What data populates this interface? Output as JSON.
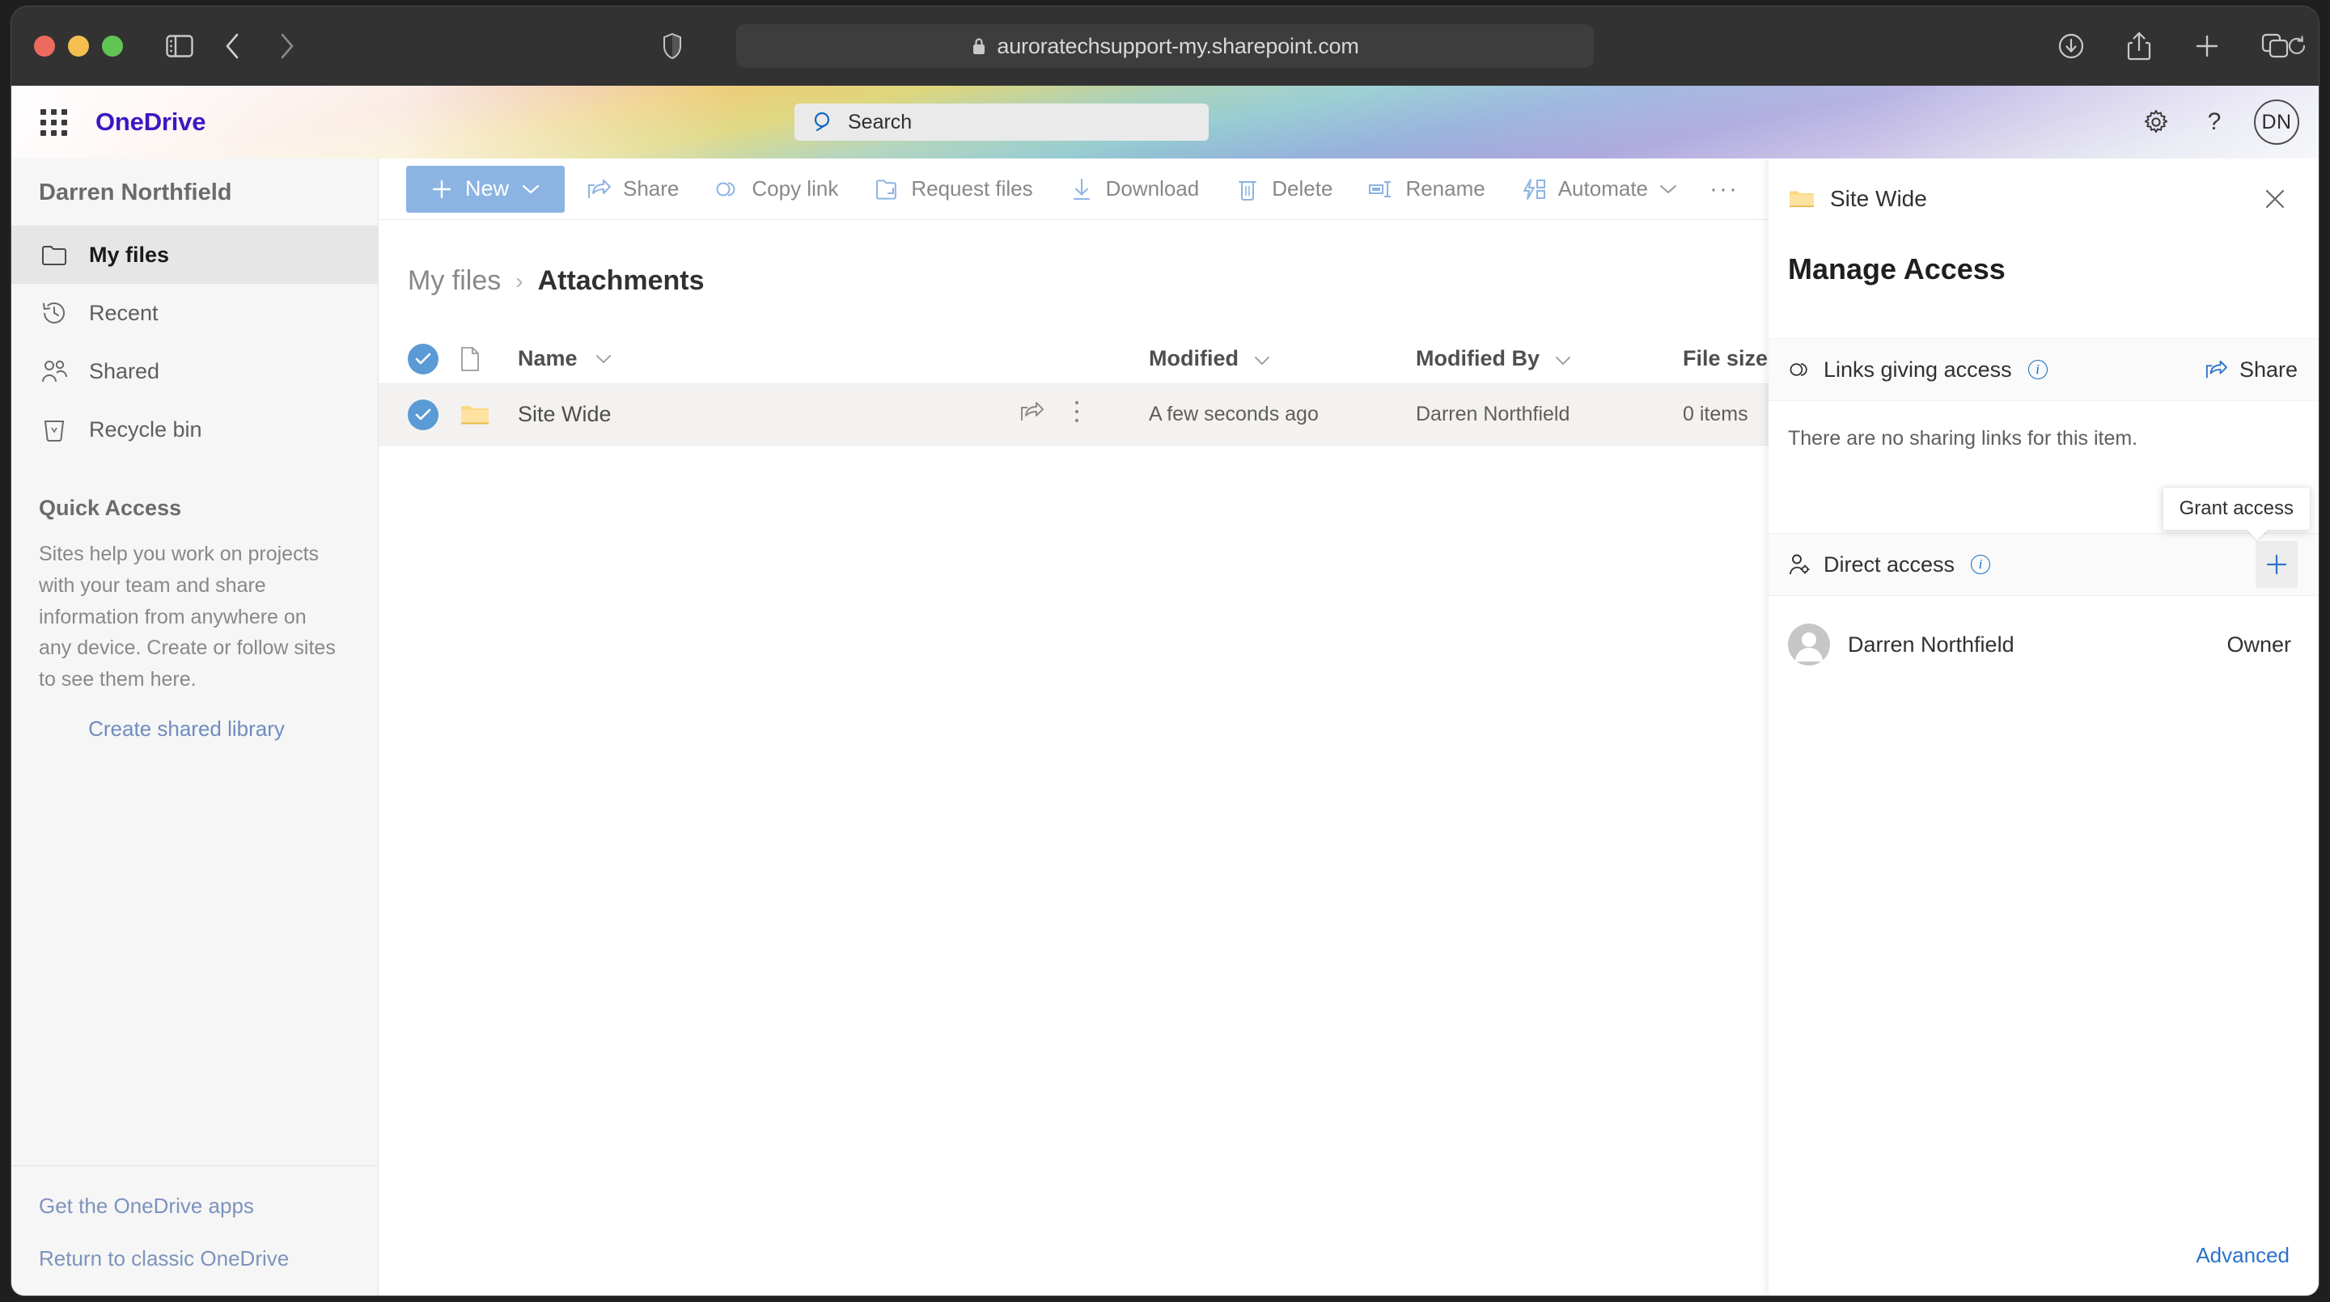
{
  "browser": {
    "url": "auroratechsupport-my.sharepoint.com",
    "lock_icon": "lock-icon",
    "back_icon": "back-chevron-icon",
    "forward_icon": "forward-chevron-icon",
    "sidebar_icon": "sidebar-toggle-icon",
    "shield_icon": "privacy-shield-icon",
    "reload_icon": "reload-icon",
    "downloads_icon": "downloads-icon",
    "share_icon": "share-icon",
    "newtab_icon": "new-tab-icon",
    "tabs_icon": "tab-overview-icon"
  },
  "suite_header": {
    "waffle_icon": "app-launcher-icon",
    "brand": "OneDrive",
    "brand_color": "#3b17c4",
    "search": {
      "placeholder": "Search",
      "icon": "search-icon"
    },
    "settings_icon": "gear-icon",
    "help_icon": "help-icon",
    "avatar_initials": "DN"
  },
  "sidebar": {
    "account_name": "Darren Northfield",
    "items": [
      {
        "label": "My files",
        "icon": "folder-icon",
        "active": true
      },
      {
        "label": "Recent",
        "icon": "clock-history-icon",
        "active": false
      },
      {
        "label": "Shared",
        "icon": "people-icon",
        "active": false
      },
      {
        "label": "Recycle bin",
        "icon": "trash-icon",
        "active": false
      }
    ],
    "quick_access": {
      "title": "Quick Access",
      "description": "Sites help you work on projects with your team and share information from anywhere on any device. Create or follow sites to see them here.",
      "link": "Create shared library"
    },
    "footer_links": [
      "Get the OneDrive apps",
      "Return to classic OneDrive"
    ]
  },
  "command_bar": {
    "new_button": {
      "label": "New",
      "plus_icon": "plus-icon",
      "chevron_icon": "chevron-down-icon",
      "color": "#8cb4e3"
    },
    "commands": [
      {
        "label": "Share",
        "icon": "share-arrow-icon"
      },
      {
        "label": "Copy link",
        "icon": "link-icon"
      },
      {
        "label": "Request files",
        "icon": "request-files-icon"
      },
      {
        "label": "Download",
        "icon": "download-arrow-icon"
      },
      {
        "label": "Delete",
        "icon": "trash-icon"
      },
      {
        "label": "Rename",
        "icon": "rename-icon"
      },
      {
        "label": "Automate",
        "icon": "automate-icon",
        "has_chevron": true
      }
    ],
    "overflow": "···"
  },
  "breadcrumb": {
    "root": "My files",
    "separator": "›",
    "current": "Attachments"
  },
  "file_list": {
    "columns": [
      {
        "label": "Name",
        "sortable": true
      },
      {
        "label": "Modified",
        "sortable": true
      },
      {
        "label": "Modified By",
        "sortable": true
      },
      {
        "label": "File size",
        "sortable": true
      }
    ],
    "select_all_checked": true,
    "rows": [
      {
        "name": "Site Wide",
        "icon": "folder-icon",
        "selected": true,
        "is_new": true,
        "modified": "A few seconds ago",
        "modified_by": "Darren Northfield",
        "size": "0 items",
        "row_share_icon": "share-arrow-icon",
        "row_more_icon": "more-vertical-icon"
      }
    ]
  },
  "details_panel": {
    "item_name": "Site Wide",
    "item_icon": "folder-icon",
    "close_icon": "close-icon",
    "heading": "Manage Access",
    "links_section": {
      "title": "Links giving access",
      "info_icon": "info-icon",
      "icon": "link-icon",
      "share_label": "Share",
      "share_icon": "share-arrow-icon",
      "empty_message": "There are no sharing links for this item."
    },
    "direct_section": {
      "title": "Direct access",
      "info_icon": "info-icon",
      "icon": "person-settings-icon",
      "add_icon": "plus-icon",
      "tooltip": "Grant access",
      "people": [
        {
          "name": "Darren Northfield",
          "role": "Owner",
          "avatar": "person-avatar"
        }
      ]
    },
    "advanced_link": "Advanced"
  }
}
